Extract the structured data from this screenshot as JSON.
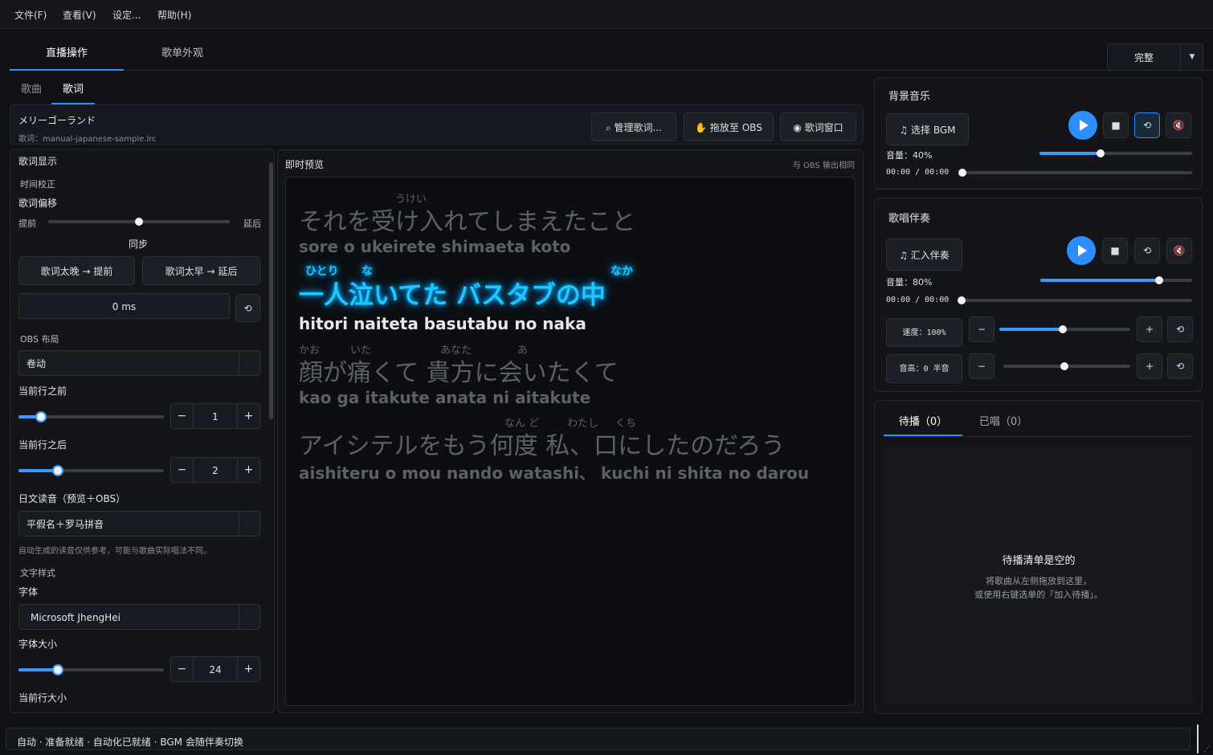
{
  "menu": [
    "文件(F)",
    "查看(V)",
    "设定...",
    "帮助(H)"
  ],
  "main_tabs": [
    "直播操作",
    "歌单外观"
  ],
  "mode": {
    "label": "完整"
  },
  "sub_tabs": [
    "歌曲",
    "歌词"
  ],
  "song": {
    "title": "メリーゴーランド",
    "lyric_file": "歌词：manual-japanese-sample.lrc",
    "buttons": {
      "manage": "管理歌词...",
      "drag": "拖放至 OBS",
      "window": "歌词窗口"
    }
  },
  "settings": {
    "section_title": "歌词显示",
    "time_calibration": "时间校正",
    "offset_label": "歌词偏移",
    "earlier": "提前",
    "later": "延后",
    "sync": "同步",
    "late_btn": "歌词太晚 → 提前",
    "early_btn": "歌词太早 → 延后",
    "offset_value": "0 ms",
    "offset_knob_fraction": 0.5,
    "obs_layout_label": "OBS 布局",
    "obs_layout_value": "卷动",
    "before_label": "当前行之前",
    "before_value": "1",
    "after_label": "当前行之后",
    "after_value": "2",
    "reading_label": "日文读音（预览＋OBS）",
    "reading_value": "平假名＋罗马拼音",
    "reading_note": "自动生成的读音仅供参考，可能与歌曲实际唱法不同。",
    "text_style_label": "文字样式",
    "font_label": "字体",
    "font_value": "Microsoft JhengHei",
    "font_size_label": "字体大小",
    "font_size_value": "24",
    "current_size_label": "当前行大小"
  },
  "preview": {
    "title": "即时预览",
    "note": "与 OBS 输出相同",
    "lines": [
      {
        "text": "それを受け入れてしまえたこと",
        "ruby": "うけい",
        "roma": "sore o ukeirete shimaeta koto",
        "active": false
      },
      {
        "text": "一人泣いてた バスタブの中",
        "ruby1": "ひとり",
        "ruby2": "な",
        "ruby3": "なか",
        "roma": "hitori naiteta basutabu no naka",
        "active": true
      },
      {
        "text": "顔が痛くて 貴方に会いたくて",
        "ruby1": "かお",
        "ruby2": "いた",
        "ruby3": "あなた",
        "ruby4": "あ",
        "roma": "kao ga itakute anata ni aitakute",
        "active": false
      },
      {
        "text": "アイシテルをもう何度 私、口にしたのだろう",
        "ruby1": "なん ど",
        "ruby2": "わたし",
        "ruby3": "くち",
        "roma": "aishiteru o mou nando watashi、 kuchi ni shita no darou",
        "active": false
      }
    ]
  },
  "bgm": {
    "title": "背景音乐",
    "select_btn": "选择 BGM",
    "volume_label": "音量：40%",
    "volume": 0.4,
    "time": "00:00 / 00:00"
  },
  "accomp": {
    "title": "歌唱伴奏",
    "import_btn": "汇入伴奏",
    "volume_label": "音量：80%",
    "volume": 0.8,
    "time": "00:00 / 00:00",
    "speed_label": "速度：100%",
    "pitch_label": "音高：0 半音"
  },
  "queue": {
    "tab_pending": "待播（0）",
    "tab_sung": "已唱（0）",
    "empty_title": "待播清单是空的",
    "empty_line1": "将歌曲从左侧拖放到这里，",
    "empty_line2": "或使用右键选单的「加入待播」。"
  },
  "status": "自动 · 准备就绪 · 自动化已就绪 · BGM 会随伴奏切换",
  "colors": {
    "accent": "#2d8dff",
    "lyric_active": "#1ec8ff",
    "lyric_dim": "#5d6066"
  }
}
